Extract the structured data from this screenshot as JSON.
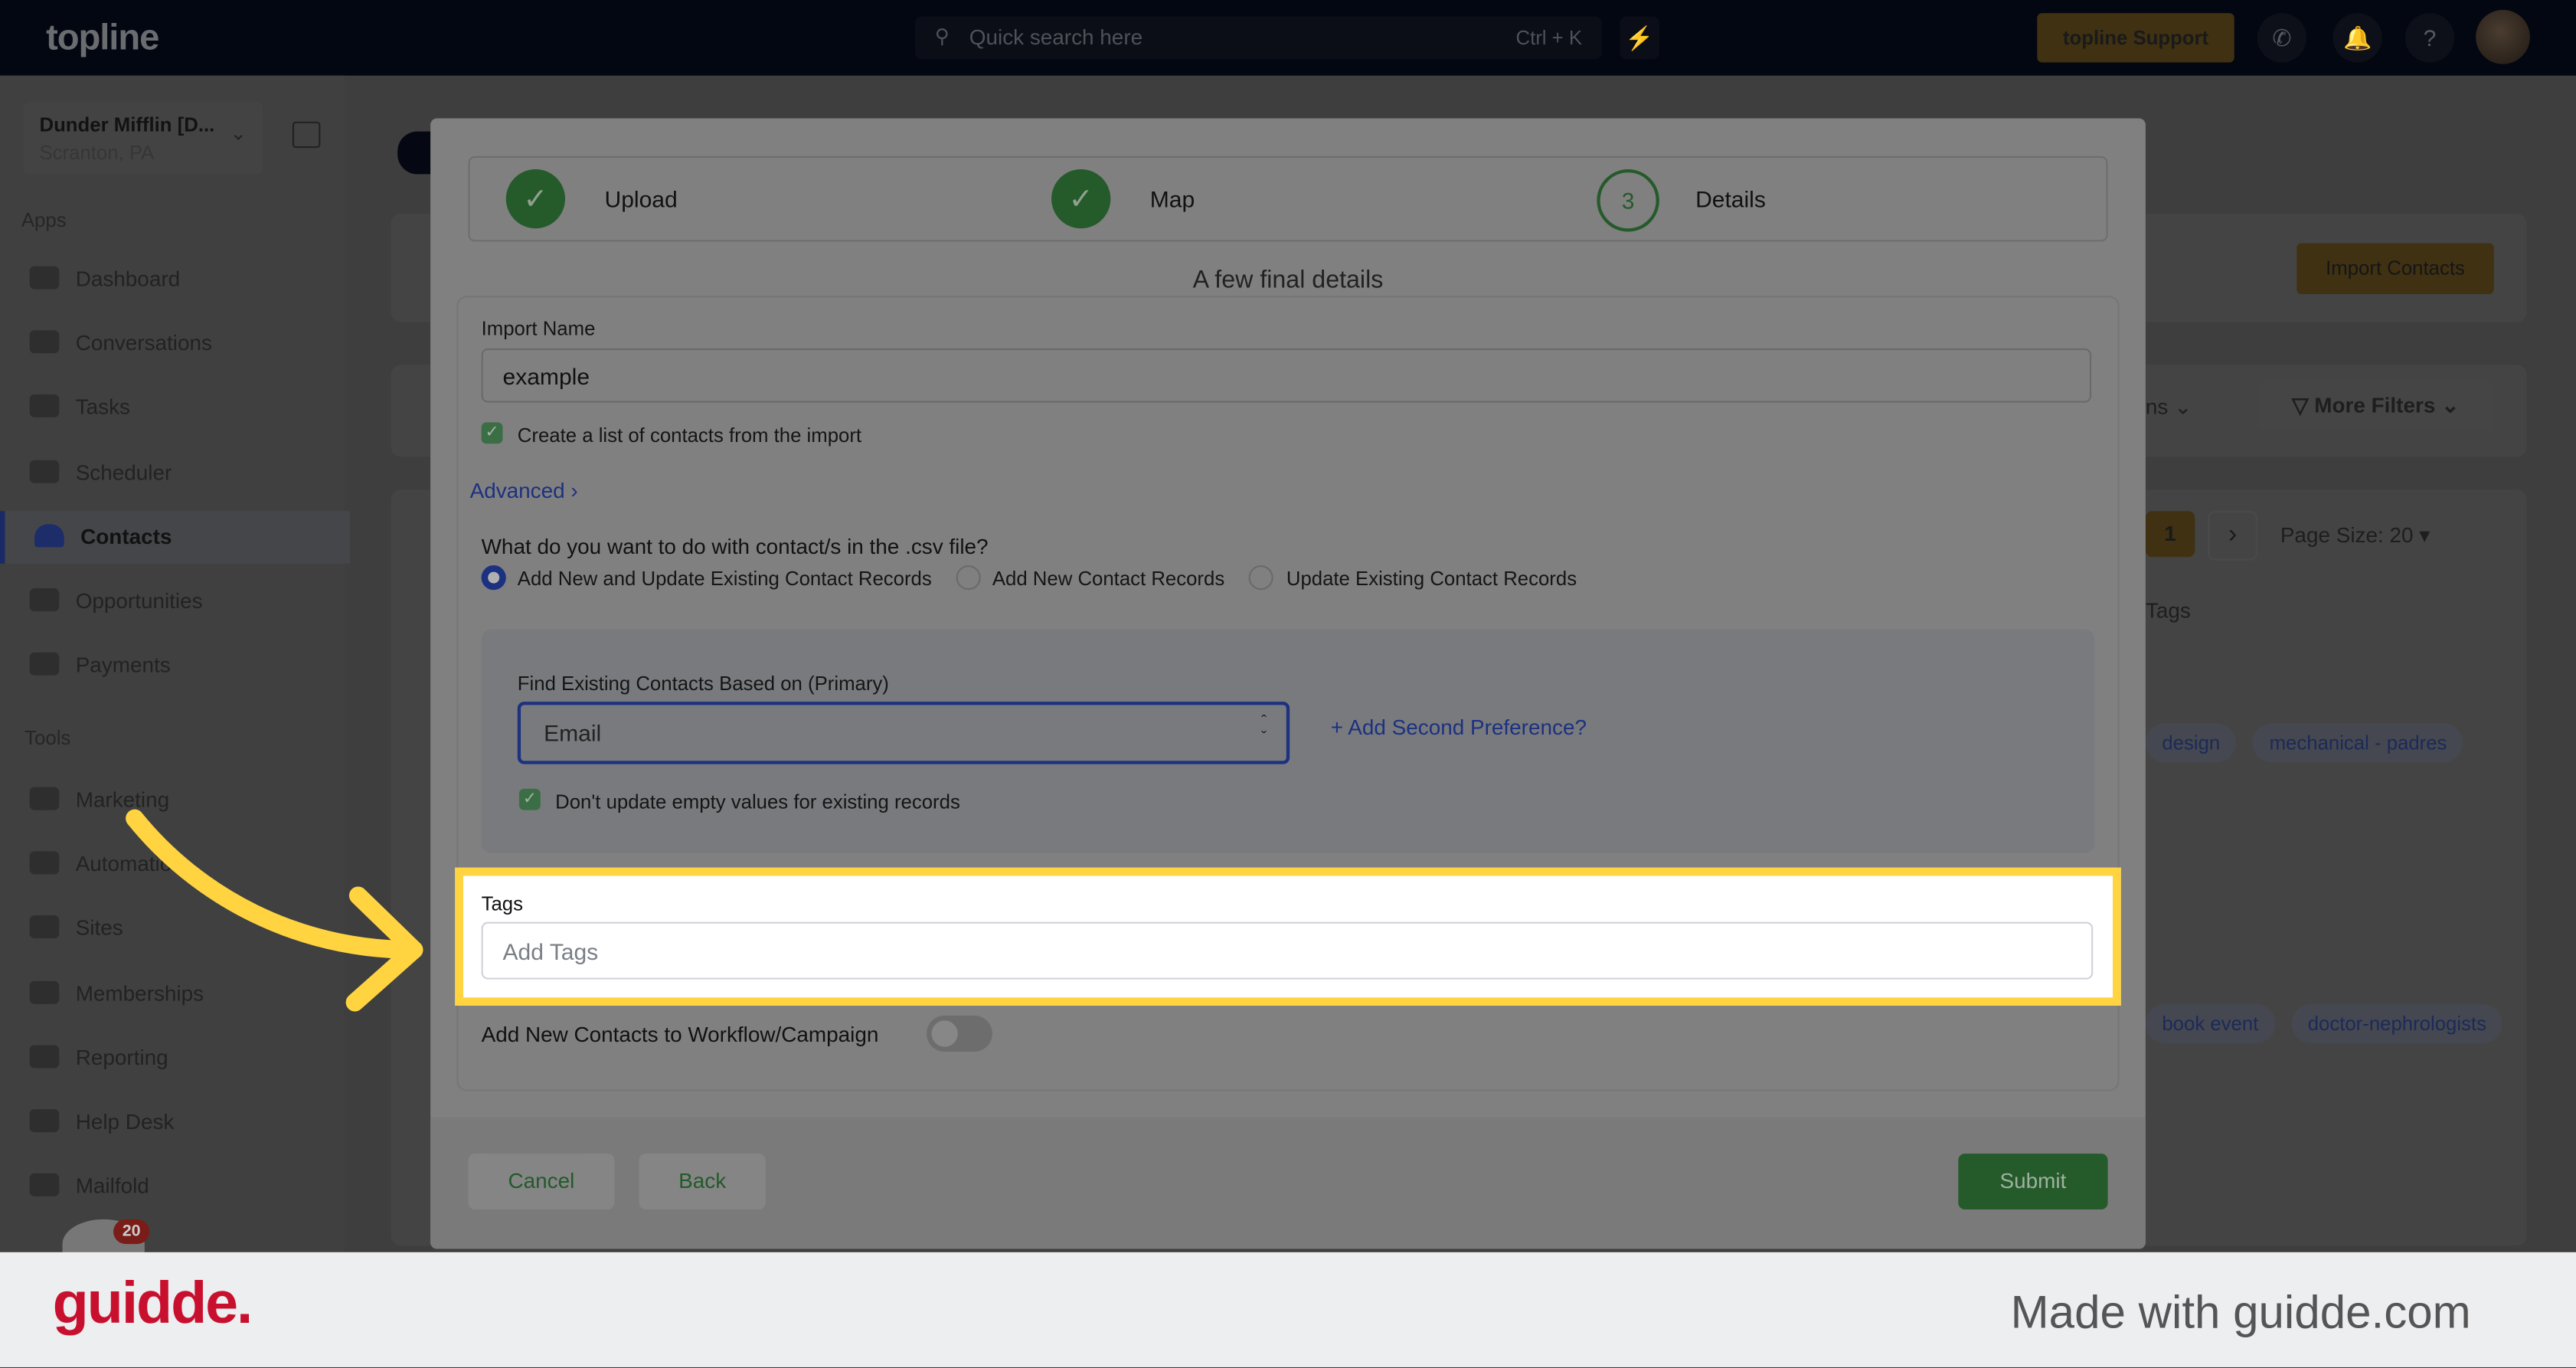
{
  "topbar": {
    "logo": "topline",
    "search_placeholder": "Quick search here",
    "search_shortcut": "Ctrl + K",
    "support_label": "topline Support"
  },
  "sidebar": {
    "account_name": "Dunder Mifflin [D...",
    "account_location": "Scranton, PA",
    "apps_heading": "Apps",
    "apps": [
      {
        "label": "Dashboard"
      },
      {
        "label": "Conversations"
      },
      {
        "label": "Tasks"
      },
      {
        "label": "Scheduler"
      },
      {
        "label": "Contacts",
        "active": true
      },
      {
        "label": "Opportunities"
      },
      {
        "label": "Payments"
      }
    ],
    "tools_heading": "Tools",
    "tools": [
      {
        "label": "Marketing"
      },
      {
        "label": "Automation"
      },
      {
        "label": "Sites"
      },
      {
        "label": "Memberships"
      },
      {
        "label": "Reporting"
      },
      {
        "label": "Help Desk"
      },
      {
        "label": "Mailfold"
      }
    ],
    "notification_count": "20"
  },
  "background": {
    "import_contacts": "Import Contacts",
    "columns_partial": "ns",
    "more_filters": "More Filters",
    "current_page": "1",
    "page_size": "Page Size: 20",
    "tags_header": "Tags",
    "tag_rows": [
      [
        "design",
        "mechanical - padres"
      ],
      [
        "book event",
        "doctor-nephrologists"
      ]
    ]
  },
  "modal": {
    "steps": [
      {
        "label": "Upload",
        "state": "done"
      },
      {
        "label": "Map",
        "state": "done"
      },
      {
        "label": "Details",
        "number": "3",
        "state": "current"
      }
    ],
    "title": "A few final details",
    "import_name_label": "Import Name",
    "import_name_value": "example",
    "create_list_label": "Create a list of contacts from the import",
    "create_list_checked": true,
    "advanced_label": "Advanced",
    "question": "What do you want to do with contact/s in the .csv file?",
    "options": [
      {
        "label": "Add New and Update Existing Contact Records",
        "selected": true
      },
      {
        "label": "Add New Contact Records",
        "selected": false
      },
      {
        "label": "Update Existing Contact Records",
        "selected": false
      }
    ],
    "find_label": "Find Existing Contacts Based on (Primary)",
    "find_value": "Email",
    "add_second": "Add Second Preference?",
    "dont_update_label": "Don't update empty values for existing records",
    "dont_update_checked": true,
    "tags_label": "Tags",
    "tags_placeholder": "Add Tags",
    "workflow_label": "Add New Contacts to Workflow/Campaign",
    "workflow_enabled": false,
    "cancel": "Cancel",
    "back": "Back",
    "submit": "Submit"
  },
  "branding": {
    "logo": "guidde.",
    "made_with": "Made with guidde.com"
  },
  "colors": {
    "highlight": "#ffd440",
    "primary_green": "#2e7d32",
    "link_blue": "#2a4cc4",
    "guidde_red": "#c8102e"
  }
}
